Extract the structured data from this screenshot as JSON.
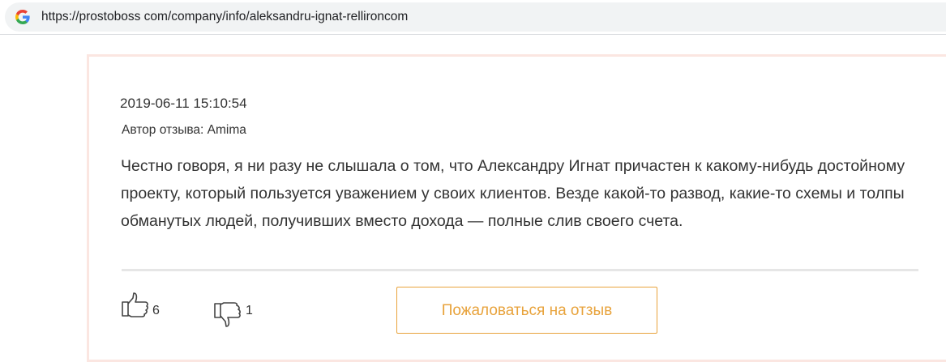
{
  "browser": {
    "url": "https://prostoboss com/company/info/aleksandru-ignat-rellironcom",
    "search_engine_icon": "google-g-icon"
  },
  "review": {
    "date": "2019-06-11 15:10:54",
    "author": "Автор отзыва: Amima",
    "text": "Честно говоря, я ни разу не слышала о том, что Александру Игнат причастен к какому-нибудь достойному проекту, который пользуется уважением у своих клиентов. Везде какой-то развод, какие-то схемы и толпы обманутых людей, получивших вместо дохода — полные слив своего счета.",
    "likes": "6",
    "dislikes": "1",
    "complain_label": "Пожаловаться на отзыв"
  },
  "colors": {
    "accent": "#e8a33c",
    "card_border": "#fbe6e1",
    "text": "#333333"
  }
}
